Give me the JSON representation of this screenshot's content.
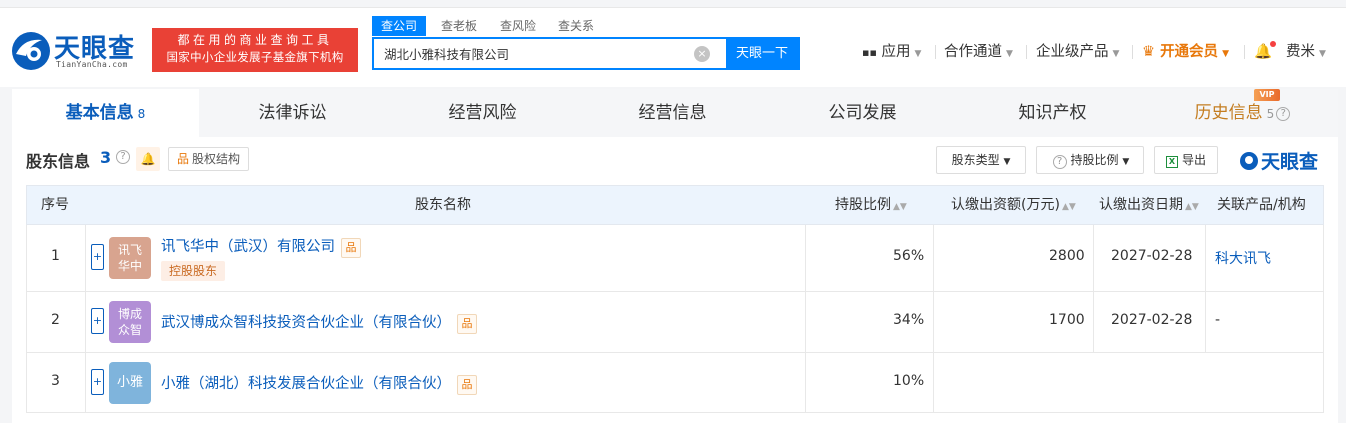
{
  "header": {
    "logo_text": "天眼查",
    "logo_domain": "TianYanCha.com",
    "banner_line1": "都在用的商业查询工具",
    "banner_line2": "国家中小企业发展子基金旗下机构",
    "search_tabs": [
      "查公司",
      "查老板",
      "查风险",
      "查关系"
    ],
    "search_value": "湖北小雅科技有限公司",
    "search_button": "天眼一下",
    "nav": {
      "apps": "应用",
      "channels": "合作通道",
      "enterprise": "企业级产品",
      "vip": "开通会员",
      "user": "费米"
    }
  },
  "tabs": [
    {
      "label": "基本信息",
      "count": "8"
    },
    {
      "label": "法律诉讼",
      "count": ""
    },
    {
      "label": "经营风险",
      "count": ""
    },
    {
      "label": "经营信息",
      "count": ""
    },
    {
      "label": "公司发展",
      "count": ""
    },
    {
      "label": "知识产权",
      "count": ""
    },
    {
      "label": "历史信息",
      "count": "5"
    }
  ],
  "vip_tag": "VIP",
  "section": {
    "title": "股东信息",
    "count": "3",
    "structure_button": "股权结构",
    "filter_type": "股东类型",
    "filter_ratio": "持股比例",
    "export": "导出",
    "brand": "天眼查"
  },
  "table": {
    "headers": [
      "序号",
      "股东名称",
      "持股比例",
      "认缴出资额(万元)",
      "认缴出资日期",
      "关联产品/机构"
    ],
    "rows": [
      {
        "no": "1",
        "avatar": "讯飞华中",
        "avatar_l1": "讯飞",
        "avatar_l2": "华中",
        "avatar_color": "#d8a48f",
        "name": "讯飞华中（武汉）有限公司",
        "tag": "控股股东",
        "ratio": "56%",
        "amount": "2800",
        "date": "2027-02-28",
        "related": "科大讯飞"
      },
      {
        "no": "2",
        "avatar": "博成众智",
        "avatar_l1": "博成",
        "avatar_l2": "众智",
        "avatar_color": "#b28fd6",
        "name": "武汉博成众智科技投资合伙企业（有限合伙）",
        "tag": "",
        "ratio": "34%",
        "amount": "1700",
        "date": "2027-02-28",
        "related": "-"
      },
      {
        "no": "3",
        "avatar": "小雅",
        "avatar_l1": "小雅",
        "avatar_l2": "",
        "avatar_color": "#7fb4dc",
        "name": "小雅（湖北）科技发展合伙企业（有限合伙）",
        "tag": "",
        "ratio": "10%",
        "amount": "",
        "date": "",
        "related": ""
      }
    ]
  },
  "colors": {
    "brand_blue": "#0a5dbb",
    "search_blue": "#0084ff",
    "banner_red": "#e94136",
    "vip_orange": "#e8780b"
  }
}
